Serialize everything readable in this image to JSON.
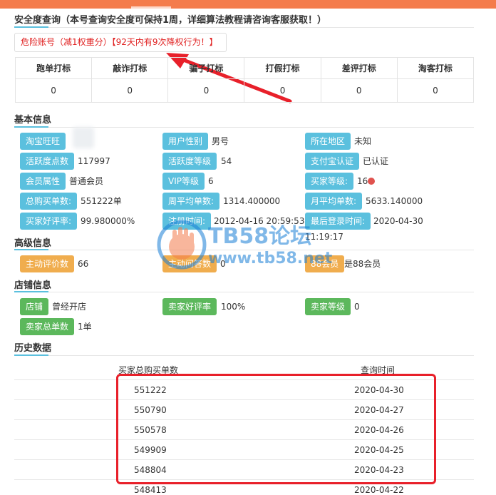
{
  "safety": {
    "title": "安全度查询（本号查询安全度可保持1周，详细算法教程请咨询客服获取！）",
    "alert": "危险账号（减1权重分）【92天内有9次降权行为！】"
  },
  "stats": {
    "headers": [
      "跑单打标",
      "敲诈打标",
      "骗子打标",
      "打假打标",
      "差评打标",
      "淘客打标"
    ],
    "values": [
      "0",
      "0",
      "0",
      "0",
      "0",
      "0"
    ]
  },
  "basic": {
    "title": "基本信息",
    "items": [
      {
        "label": "淘宝旺旺",
        "value": ""
      },
      {
        "label": "用户性别",
        "value": "男号"
      },
      {
        "label": "所在地区",
        "value": "未知"
      },
      {
        "label": "活跃度点数",
        "value": "117997"
      },
      {
        "label": "活跃度等级",
        "value": "54"
      },
      {
        "label": "支付宝认证",
        "value": "已认证"
      },
      {
        "label": "会员属性",
        "value": "普通会员"
      },
      {
        "label": "VIP等级",
        "value": "6"
      },
      {
        "label": "买家等级:",
        "value": "16"
      },
      {
        "label": "总购买单数:",
        "value": "551222单"
      },
      {
        "label": "周平均单数:",
        "value": "1314.400000"
      },
      {
        "label": "月平均单数:",
        "value": "5633.140000"
      },
      {
        "label": "买家好评率:",
        "value": "99.980000%"
      },
      {
        "label": "注册时间:",
        "value": "2012-04-16 20:59:53"
      },
      {
        "label": "最后登录时间:",
        "value": "2020-04-30"
      }
    ],
    "last_login_time": "11:19:17"
  },
  "advanced": {
    "title": "高级信息",
    "items": [
      {
        "label": "主动评价数",
        "value": "66"
      },
      {
        "label": "主动问答数",
        "value": "0"
      },
      {
        "label": "88会员",
        "value": "是88会员"
      }
    ]
  },
  "shop": {
    "title": "店铺信息",
    "items": [
      {
        "label": "店铺",
        "value": "曾经开店"
      },
      {
        "label": "卖家好评率",
        "value": "100%"
      },
      {
        "label": "卖家等级",
        "value": "0"
      },
      {
        "label": "卖家总单数",
        "value": "1单"
      }
    ]
  },
  "history": {
    "title": "历史数据",
    "col1": "买家总购买单数",
    "col2": "查询时间",
    "rows": [
      {
        "count": "551222",
        "date": "2020-04-30"
      },
      {
        "count": "550790",
        "date": "2020-04-27"
      },
      {
        "count": "550578",
        "date": "2020-04-26"
      },
      {
        "count": "549909",
        "date": "2020-04-25"
      },
      {
        "count": "548804",
        "date": "2020-04-23"
      },
      {
        "count": "548413",
        "date": "2020-04-22"
      }
    ]
  },
  "watermark": {
    "line1": "TB58论坛",
    "line2": "www.tb58.net"
  },
  "colors": {
    "blue_label": "#5bc0de",
    "orange_label": "#f0ad4e",
    "green_label": "#5cb85c",
    "alert_text": "#e02020",
    "annotation_red": "#e8202a",
    "top_bar": "#f47c4c"
  }
}
